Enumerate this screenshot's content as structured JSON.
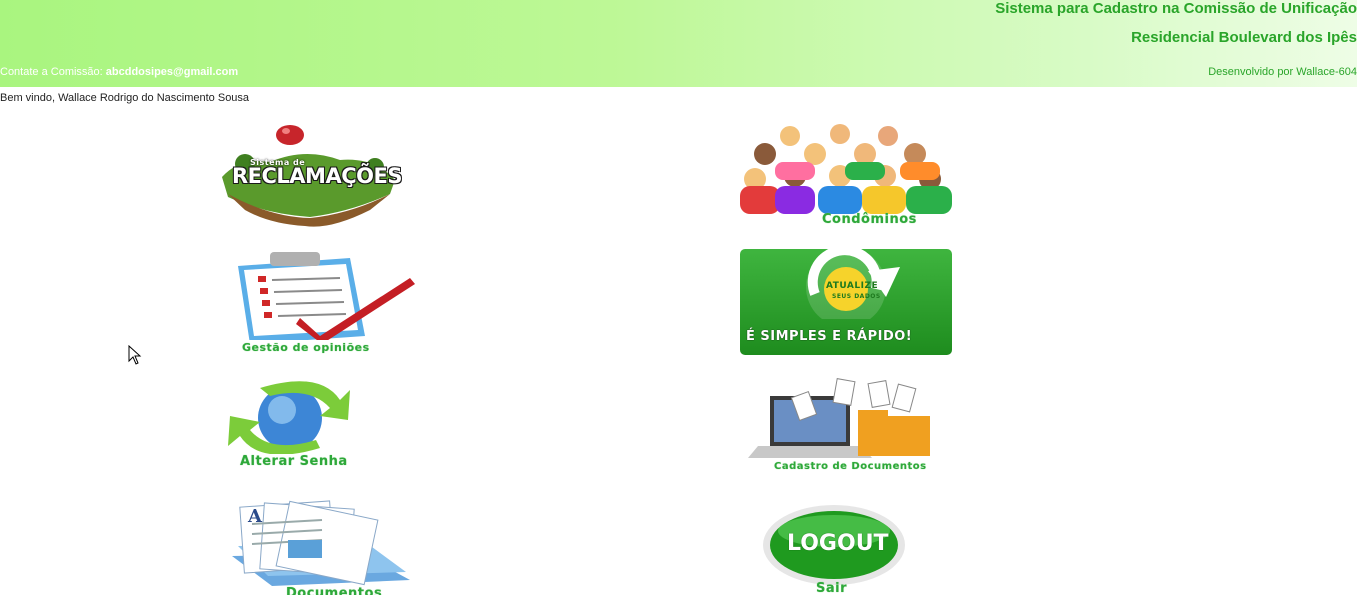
{
  "header": {
    "title_line1": "Sistema para Cadastro na Comissão de Unificação",
    "title_line2": "Residencial Boulevard dos Ipês",
    "contact_label": "Contate a Comissão:",
    "contact_email": "abcddosipes@gmail.com",
    "developed_by": "Desenvolvido por Wallace-604"
  },
  "welcome": "Bem vindo, Wallace Rodrigo do Nascimento Sousa",
  "menu": {
    "reclamacoes": {
      "banner_small": "Sistema de",
      "banner_big": "RECLAMAÇÕES"
    },
    "condominos": {
      "label": "Condôminos"
    },
    "gestao": {
      "label": "Gestão de opiniões"
    },
    "atualize": {
      "line1": "ATUALIZE",
      "line2": "SEUS DADOS",
      "tagline": "É SIMPLES E RÁPIDO!"
    },
    "senha": {
      "label": "Alterar Senha"
    },
    "documentos_cadastro": {
      "label": "Cadastro de Documentos"
    },
    "documentos": {
      "label": "Documentos"
    },
    "logout": {
      "badge": "LOGOUT",
      "label": "Sair"
    }
  },
  "colors": {
    "accent_green": "#2aa52a",
    "header_start": "#a9f57f",
    "header_end": "#eefde6"
  }
}
